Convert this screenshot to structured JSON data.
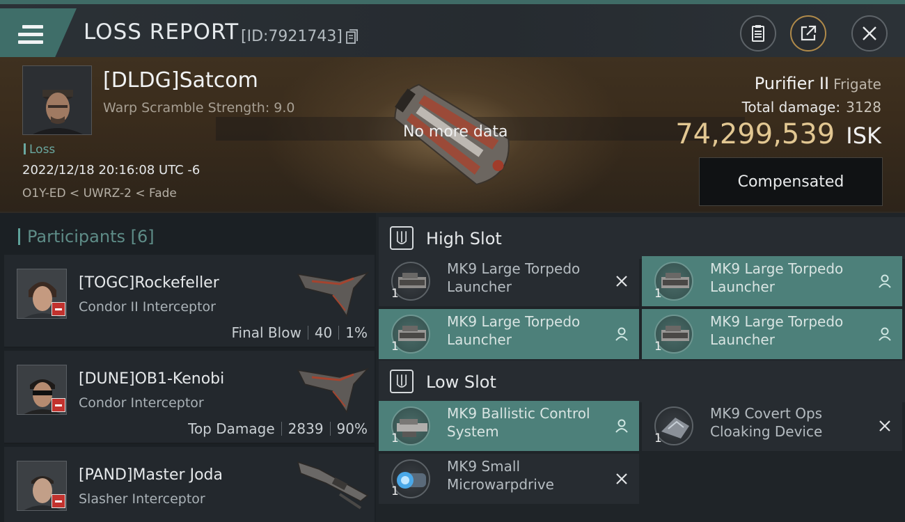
{
  "header": {
    "title": "LOSS REPORT",
    "report_id": "[ID:7921743]"
  },
  "victim": {
    "name": "[DLDG]Satcom",
    "scramble": "Warp Scramble Strength: 9.0",
    "tag": "Loss",
    "datetime": "2022/12/18 20:16:08 UTC -6",
    "location": "O1Y-ED < UWRZ-2 < Fade",
    "no_data": "No more data",
    "ship": "Purifier II",
    "ship_class": "Frigate",
    "total_damage_label": "Total damage:",
    "total_damage": "3128",
    "isk_value": "74,299,539",
    "isk_unit": "ISK",
    "compensated_label": "Compensated"
  },
  "participants": {
    "title": "Participants",
    "count": "[6]",
    "items": [
      {
        "name": "[TOGC]Rockefeller",
        "ship": "Condor II Interceptor",
        "role": "Final Blow",
        "damage": "40",
        "percent": "1%"
      },
      {
        "name": "[DUNE]OB1-Kenobi",
        "ship": "Condor Interceptor",
        "role": "Top Damage",
        "damage": "2839",
        "percent": "90%"
      },
      {
        "name": "[PAND]Master Joda",
        "ship": "Slasher Interceptor"
      }
    ]
  },
  "fittings": {
    "high_slot_label": "High Slot",
    "low_slot_label": "Low Slot",
    "high": [
      {
        "name": "MK9 Large Torpedo Launcher",
        "qty": "1",
        "status": "destroyed"
      },
      {
        "name": "MK9 Large Torpedo Launcher",
        "qty": "1",
        "status": "dropped"
      },
      {
        "name": "MK9 Large Torpedo Launcher",
        "qty": "1",
        "status": "dropped"
      },
      {
        "name": "MK9 Large Torpedo Launcher",
        "qty": "1",
        "status": "dropped"
      }
    ],
    "low": [
      {
        "name": "MK9 Ballistic Control System",
        "qty": "1",
        "status": "dropped"
      },
      {
        "name": "MK9 Covert Ops Cloaking Device",
        "qty": "1",
        "status": "destroyed"
      },
      {
        "name": "MK9 Small Microwarpdrive",
        "qty": "1",
        "status": "destroyed"
      }
    ]
  },
  "colors": {
    "accent_teal": "#4d807a",
    "isk_gold": "#e2c792",
    "loss_red": "#c2322e"
  },
  "icons": {
    "menu": "menu-icon",
    "copy": "copy-icon",
    "clipboard": "clipboard-icon",
    "share": "share-icon",
    "close": "close-icon",
    "destroyed": "x-mark-icon",
    "dropped": "person-icon"
  }
}
